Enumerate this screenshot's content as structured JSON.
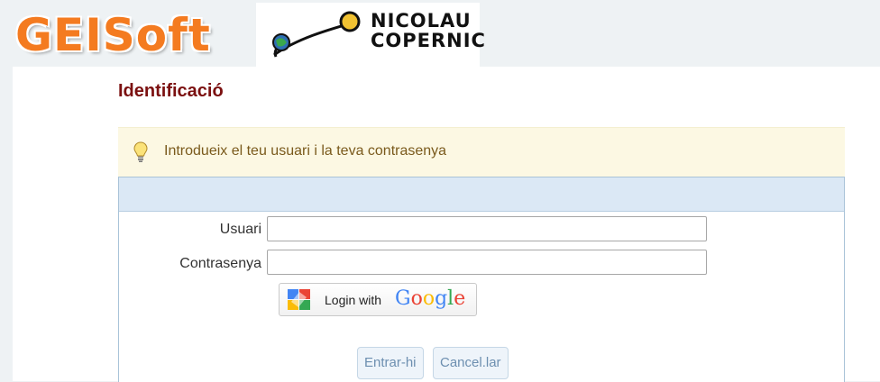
{
  "header": {
    "brand": "GEISoft",
    "school_logo_line1": "NICOLAU",
    "school_logo_line2": "COPERNIC"
  },
  "page": {
    "title": "Identificació",
    "hint": "Introdueix el teu usuari i la teva contrasenya"
  },
  "form": {
    "user_label": "Usuari",
    "user_value": "",
    "password_label": "Contrasenya",
    "password_value": "",
    "google_login_text": "Login with",
    "google_brand": [
      "G",
      "o",
      "o",
      "g",
      "l",
      "e"
    ],
    "submit_label": "Entrar-hi",
    "cancel_label": "Cancel.lar"
  },
  "colors": {
    "brand_orange": "#f47b20",
    "title_red": "#7b1010",
    "hint_bg": "#fcf8e3",
    "hint_text": "#7a5a1c",
    "form_header_bg": "#dbe8f5",
    "google_colors": [
      "#4285f4",
      "#ea4335",
      "#fbbc05",
      "#4285f4",
      "#34a853",
      "#ea4335"
    ]
  },
  "icons": {
    "hint_icon": "lightbulb-icon",
    "google_icon": "google-squares-icon"
  }
}
